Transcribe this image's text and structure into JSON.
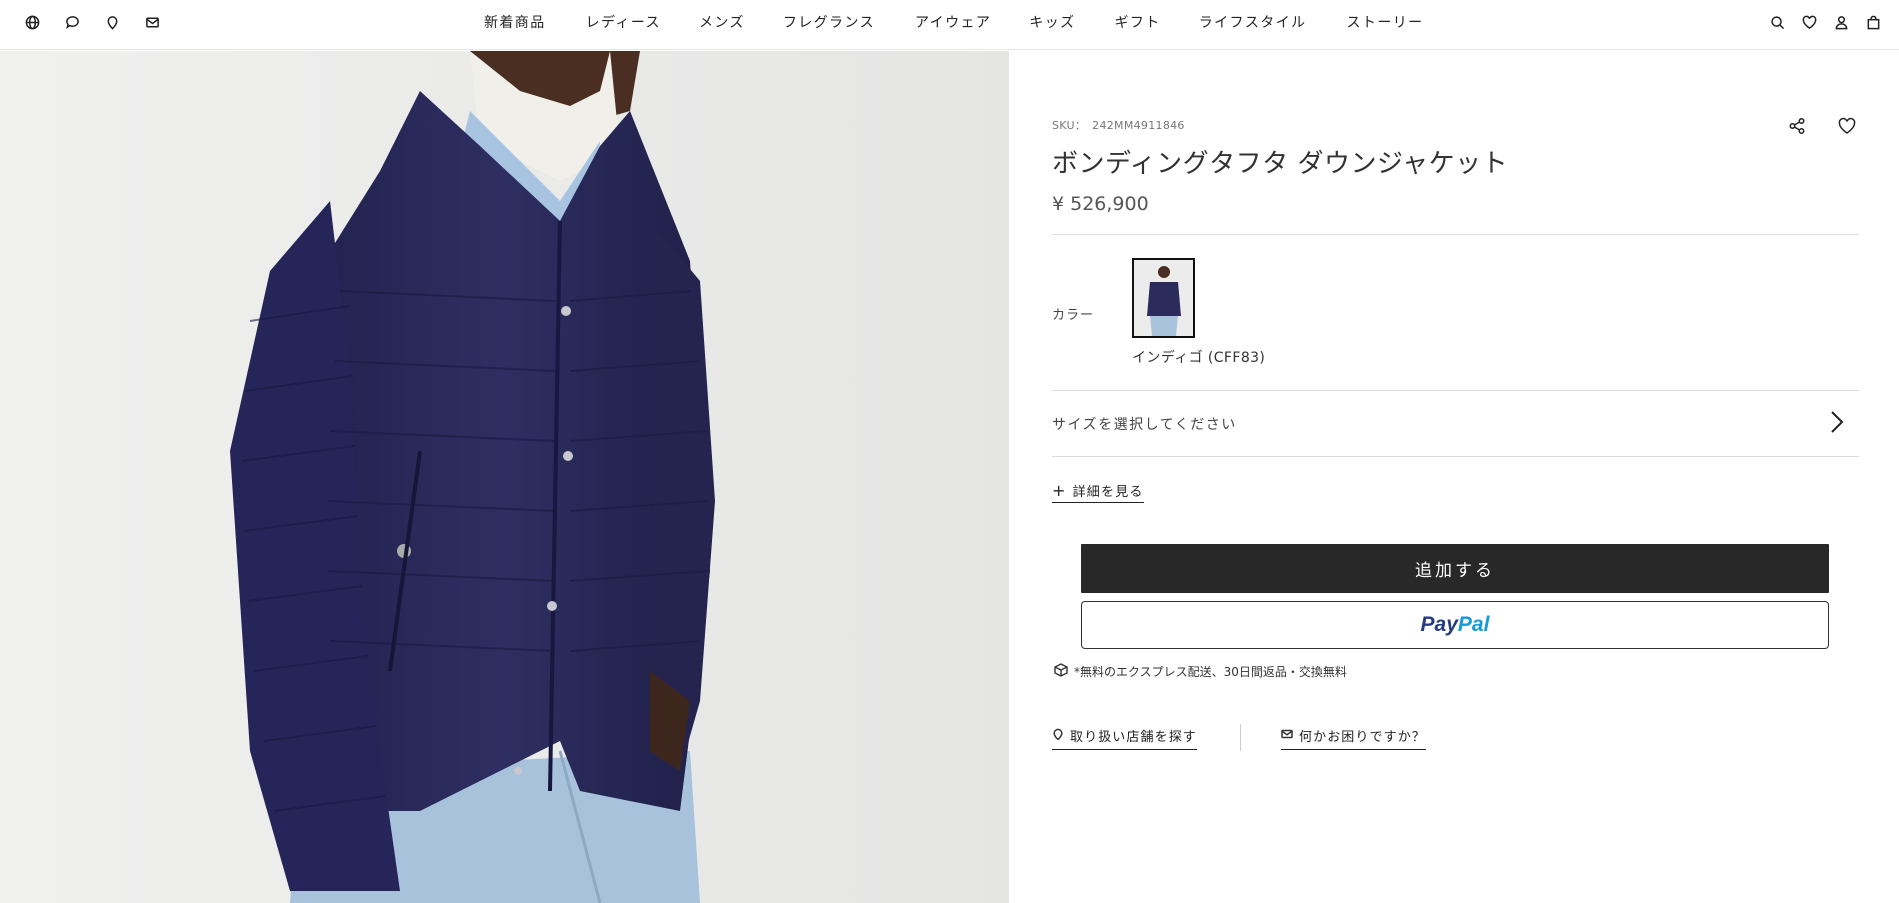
{
  "header": {
    "left_icons": [
      "globe-icon",
      "chat-icon",
      "location-pin-icon",
      "mail-icon"
    ],
    "nav": [
      "新着商品",
      "レディース",
      "メンズ",
      "フレグランス",
      "アイウェア",
      "キッズ",
      "ギフト",
      "ライフスタイル",
      "ストーリー"
    ],
    "right_icons": [
      "search-icon",
      "heart-icon",
      "user-icon",
      "bag-icon"
    ]
  },
  "product": {
    "sku_label": "SKU：",
    "sku": "242MM4911846",
    "title": "ボンディングタフタ ダウンジャケット",
    "price": "¥ 526,900",
    "color_label": "カラー",
    "color_name": "インディゴ (CFF83)",
    "size_prompt": "サイズを選択してください",
    "details_label": "詳細を見る",
    "add_button": "追加する",
    "paypal_pay": "Pay",
    "paypal_pal": "Pal",
    "shipping_note": "*無料のエクスプレス配送、30日間返品・交換無料",
    "store_link": "取り扱い店舗を探す",
    "help_link": "何かお困りですか？"
  },
  "colors": {
    "jacket": "#2b2b5c",
    "button_dark": "#282828",
    "paypal_blue_dark": "#253b80",
    "paypal_blue_light": "#179bd7"
  }
}
